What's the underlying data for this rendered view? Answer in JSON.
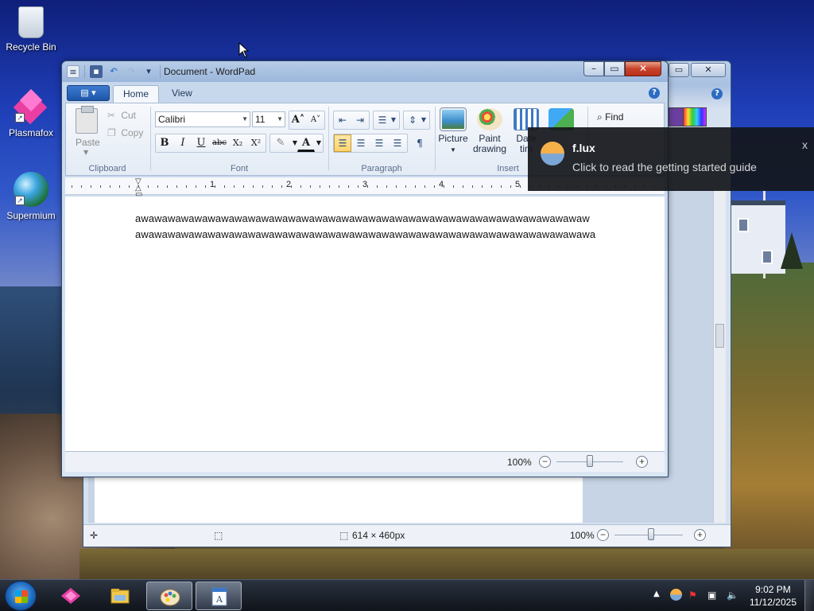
{
  "desktop": {
    "icons": [
      {
        "label": "Recycle Bin"
      },
      {
        "label": "Plasmafox"
      },
      {
        "label": "Supermium"
      }
    ]
  },
  "paint_window": {
    "status_dimensions": "614 × 460px",
    "zoom": "100%"
  },
  "wordpad": {
    "title": "Document - WordPad",
    "tabs": {
      "home": "Home",
      "view": "View"
    },
    "clipboard": {
      "paste": "Paste",
      "cut": "Cut",
      "copy": "Copy",
      "group": "Clipboard"
    },
    "font": {
      "family": "Calibri",
      "size": "11",
      "group": "Font"
    },
    "paragraph": {
      "group": "Paragraph"
    },
    "insert": {
      "picture": "Picture",
      "paint_drawing_1": "Paint",
      "paint_drawing_2": "drawing",
      "date_time_1": "Date",
      "date_time_2": "tim",
      "group": "Insert"
    },
    "editing": {
      "find": "Find"
    },
    "ruler_numbers": [
      "1",
      "2",
      "3",
      "4",
      "5"
    ],
    "document_lines": [
      "awawawawawawawawawawawawawawawawawawawawawawawawawawawawawawawawawaw",
      "awawawawawawawawawawawawawawawawawawawawawawawawawawawawawawawawawawa"
    ],
    "zoom": "100%"
  },
  "notification": {
    "app": "f.lux",
    "message": "Click to read the getting started guide",
    "close": "x"
  },
  "taskbar": {
    "clock_time": "9:02 PM",
    "clock_date": "11/12/2025"
  }
}
